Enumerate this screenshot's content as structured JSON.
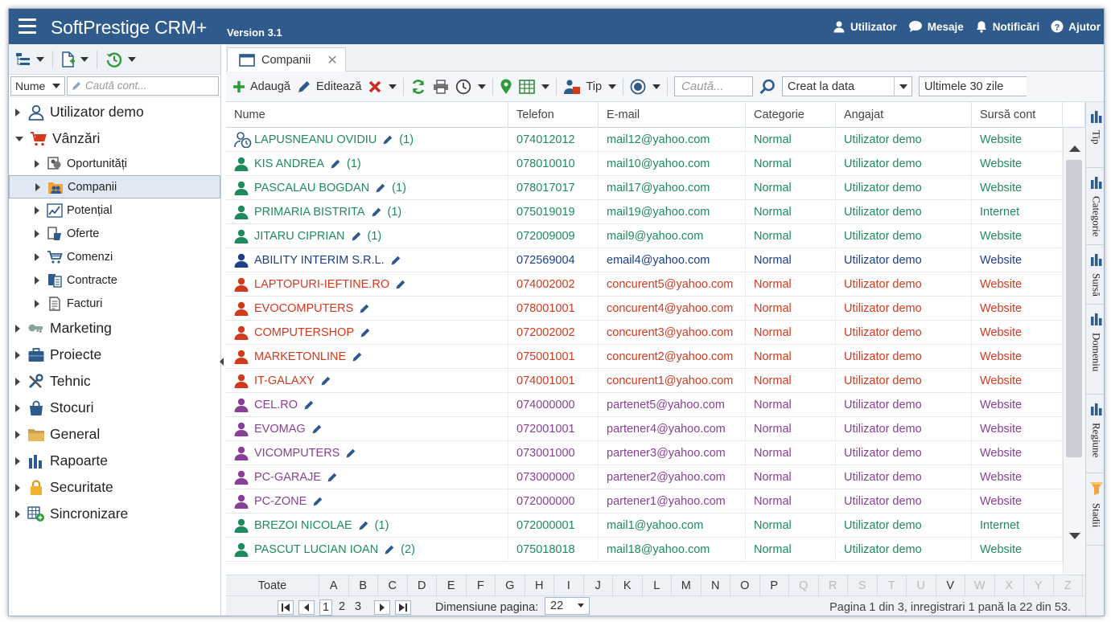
{
  "app": {
    "title": "SoftPrestige CRM+",
    "version": "Version 3.1"
  },
  "topnav": [
    {
      "label": "Utilizator",
      "icon": "user-icon"
    },
    {
      "label": "Mesaje",
      "icon": "chat-icon"
    },
    {
      "label": "Notificări",
      "icon": "bell-icon"
    },
    {
      "label": "Ajutor",
      "icon": "help-icon"
    }
  ],
  "sidebar": {
    "filter_select": "Nume",
    "search_placeholder": "Caută cont...",
    "items": [
      {
        "label": "Utilizator demo",
        "icon": "user-outline-icon",
        "open": false
      },
      {
        "label": "Vânzări",
        "icon": "cart-icon",
        "open": true
      },
      {
        "label": "Oportunități",
        "icon": "opportunity-icon",
        "sub": true
      },
      {
        "label": "Companii",
        "icon": "companies-icon",
        "sub": true,
        "selected": true
      },
      {
        "label": "Potențial",
        "icon": "chart-line-icon",
        "sub": true
      },
      {
        "label": "Oferte",
        "icon": "offers-icon",
        "sub": true
      },
      {
        "label": "Comenzi",
        "icon": "cart-outline-icon",
        "sub": true
      },
      {
        "label": "Contracte",
        "icon": "contracts-icon",
        "sub": true
      },
      {
        "label": "Facturi",
        "icon": "invoice-icon",
        "sub": true
      },
      {
        "label": "Marketing",
        "icon": "marketing-icon"
      },
      {
        "label": "Proiecte",
        "icon": "briefcase-icon"
      },
      {
        "label": "Tehnic",
        "icon": "tools-icon"
      },
      {
        "label": "Stocuri",
        "icon": "bag-icon"
      },
      {
        "label": "General",
        "icon": "folder-icon"
      },
      {
        "label": "Rapoarte",
        "icon": "bar-chart-icon"
      },
      {
        "label": "Securitate",
        "icon": "lock-icon"
      },
      {
        "label": "Sincronizare",
        "icon": "sync-table-icon"
      }
    ]
  },
  "tab": {
    "label": "Companii"
  },
  "toolbar": {
    "add_label": "Adaugă",
    "edit_label": "Editează",
    "type_label": "Tip",
    "search_placeholder": "Caută...",
    "created_select": "Creat la data",
    "period_select": "Ultimele 30 zile"
  },
  "columns": [
    "Nume",
    "Telefon",
    "E-mail",
    "Categorie",
    "Angajat",
    "Sursă cont"
  ],
  "rows": [
    {
      "name": "LAPUSNEANU OVIDIU",
      "count": "(1)",
      "phone": "074012012",
      "email": "mail12@yahoo.com",
      "category": "Normal",
      "employee": "Utilizator demo",
      "source": "Website",
      "color": "green",
      "icon": "user-clock"
    },
    {
      "name": "KIS ANDREA",
      "count": "(1)",
      "phone": "078010010",
      "email": "mail10@yahoo.com",
      "category": "Normal",
      "employee": "Utilizator demo",
      "source": "Website",
      "color": "green",
      "icon": "user"
    },
    {
      "name": "PASCALAU BOGDAN",
      "count": "(1)",
      "phone": "078017017",
      "email": "mail17@yahoo.com",
      "category": "Normal",
      "employee": "Utilizator demo",
      "source": "Website",
      "color": "green",
      "icon": "user"
    },
    {
      "name": "PRIMARIA BISTRITA",
      "count": "(1)",
      "phone": "075019019",
      "email": "mail19@yahoo.com",
      "category": "Normal",
      "employee": "Utilizator demo",
      "source": "Internet",
      "color": "green",
      "icon": "user"
    },
    {
      "name": "JITARU CIPRIAN",
      "count": "(1)",
      "phone": "072009009",
      "email": "mail9@yahoo.com",
      "category": "Normal",
      "employee": "Utilizator demo",
      "source": "Website",
      "color": "green",
      "icon": "user"
    },
    {
      "name": "ABILITY INTERIM S.R.L.",
      "count": "",
      "phone": "072569004",
      "email": "email4@yahoo.com",
      "category": "Normal",
      "employee": "Utilizator demo",
      "source": "Website",
      "color": "blue",
      "icon": "user"
    },
    {
      "name": "LAPTOPURI-IEFTINE.RO",
      "count": "",
      "phone": "074002002",
      "email": "concurent5@yahoo.com",
      "category": "Normal",
      "employee": "Utilizator demo",
      "source": "Website",
      "color": "red",
      "icon": "user"
    },
    {
      "name": "EVOCOMPUTERS",
      "count": "",
      "phone": "078001001",
      "email": "concurent4@yahoo.com",
      "category": "Normal",
      "employee": "Utilizator demo",
      "source": "Website",
      "color": "red",
      "icon": "user"
    },
    {
      "name": "COMPUTERSHOP",
      "count": "",
      "phone": "072002002",
      "email": "concurent3@yahoo.com",
      "category": "Normal",
      "employee": "Utilizator demo",
      "source": "Website",
      "color": "red",
      "icon": "user"
    },
    {
      "name": "MARKETONLINE",
      "count": "",
      "phone": "075001001",
      "email": "concurent2@yahoo.com",
      "category": "Normal",
      "employee": "Utilizator demo",
      "source": "Website",
      "color": "red",
      "icon": "user"
    },
    {
      "name": "IT-GALAXY",
      "count": "",
      "phone": "074001001",
      "email": "concurent1@yahoo.com",
      "category": "Normal",
      "employee": "Utilizator demo",
      "source": "Website",
      "color": "red",
      "icon": "user"
    },
    {
      "name": "CEL.RO",
      "count": "",
      "phone": "074000000",
      "email": "partenet5@yahoo.com",
      "category": "Normal",
      "employee": "Utilizator demo",
      "source": "Website",
      "color": "purple",
      "icon": "user"
    },
    {
      "name": "EVOMAG",
      "count": "",
      "phone": "072001001",
      "email": "partener4@yahoo.com",
      "category": "Normal",
      "employee": "Utilizator demo",
      "source": "Website",
      "color": "purple",
      "icon": "user"
    },
    {
      "name": "VICOMPUTERS",
      "count": "",
      "phone": "073001000",
      "email": "partener3@yahoo.com",
      "category": "Normal",
      "employee": "Utilizator demo",
      "source": "Website",
      "color": "purple",
      "icon": "user"
    },
    {
      "name": "PC-GARAJE",
      "count": "",
      "phone": "073000000",
      "email": "partener2@yahoo.com",
      "category": "Normal",
      "employee": "Utilizator demo",
      "source": "Website",
      "color": "purple",
      "icon": "user"
    },
    {
      "name": "PC-ZONE",
      "count": "",
      "phone": "072000000",
      "email": "partener1@yahoo.com",
      "category": "Normal",
      "employee": "Utilizator demo",
      "source": "Website",
      "color": "purple",
      "icon": "user"
    },
    {
      "name": "BREZOI NICOLAE",
      "count": "(1)",
      "phone": "072000001",
      "email": "mail1@yahoo.com",
      "category": "Normal",
      "employee": "Utilizator demo",
      "source": "Internet",
      "color": "green",
      "icon": "user"
    },
    {
      "name": "PASCUT LUCIAN IOAN",
      "count": "(2)",
      "phone": "075018018",
      "email": "mail18@yahoo.com",
      "category": "Normal",
      "employee": "Utilizator demo",
      "source": "Website",
      "color": "green",
      "icon": "user"
    }
  ],
  "alphabet": {
    "all_label": "Toate",
    "letters": [
      "A",
      "B",
      "C",
      "D",
      "E",
      "F",
      "G",
      "H",
      "I",
      "J",
      "K",
      "L",
      "M",
      "N",
      "O",
      "P",
      "Q",
      "R",
      "S",
      "T",
      "U",
      "V",
      "W",
      "X",
      "Y",
      "Z"
    ],
    "disabled": [
      "Q",
      "R",
      "S",
      "T",
      "U",
      "W",
      "X",
      "Y",
      "Z"
    ]
  },
  "pager": {
    "pages": [
      "1",
      "2",
      "3"
    ],
    "current_page": "1",
    "page_size_label": "Dimensiune pagina:",
    "page_size": "22",
    "summary": "Pagina 1 din 3, inregistrari 1 pană la 22 din 53."
  },
  "right_panel": [
    {
      "label": "Tip",
      "icon": "bar-chart-icon"
    },
    {
      "label": "Categorie",
      "icon": "bar-chart-icon"
    },
    {
      "label": "Sursă",
      "icon": "bar-chart-icon"
    },
    {
      "label": "Domeniu",
      "icon": "bar-chart-icon"
    },
    {
      "label": "Regiune",
      "icon": "bar-chart-icon"
    },
    {
      "label": "Stadii",
      "icon": "funnel-icon"
    }
  ],
  "colors": {
    "topbar": "#2e5a8c",
    "green": "#1f8a5e",
    "blue": "#1c3f88",
    "red": "#d23a1e",
    "purple": "#8a3f96"
  }
}
